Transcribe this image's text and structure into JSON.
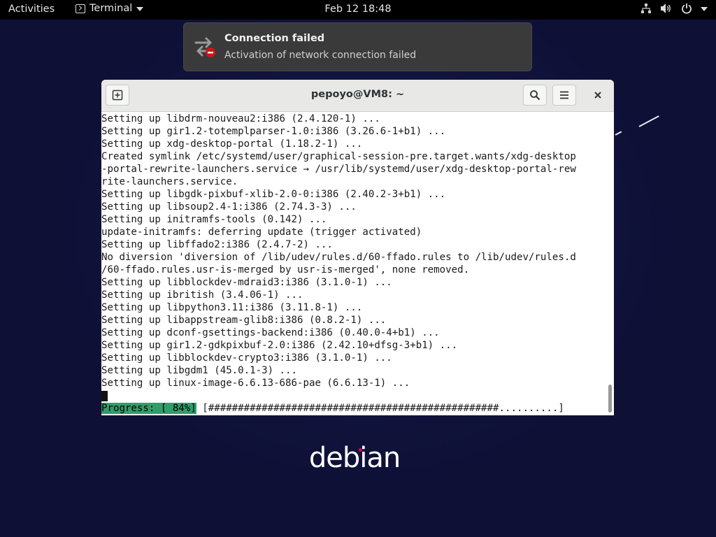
{
  "topbar": {
    "activities": "Activities",
    "app_name": "Terminal",
    "clock": "Feb 12  18:48"
  },
  "notification": {
    "title": "Connection failed",
    "body": "Activation of network connection failed",
    "icon": "network-error-icon"
  },
  "terminal": {
    "title": "pepoyo@VM8: ~",
    "lines": [
      "Setting up libdrm-nouveau2:i386 (2.4.120-1) ...",
      "Setting up gir1.2-totemplparser-1.0:i386 (3.26.6-1+b1) ...",
      "Setting up xdg-desktop-portal (1.18.2-1) ...",
      "Created symlink /etc/systemd/user/graphical-session-pre.target.wants/xdg-desktop",
      "-portal-rewrite-launchers.service → /usr/lib/systemd/user/xdg-desktop-portal-rew",
      "rite-launchers.service.",
      "Setting up libgdk-pixbuf-xlib-2.0-0:i386 (2.40.2-3+b1) ...",
      "Setting up libsoup2.4-1:i386 (2.74.3-3) ...",
      "Setting up initramfs-tools (0.142) ...",
      "update-initramfs: deferring update (trigger activated)",
      "Setting up libffado2:i386 (2.4.7-2) ...",
      "No diversion 'diversion of /lib/udev/rules.d/60-ffado.rules to /lib/udev/rules.d",
      "/60-ffado.rules.usr-is-merged by usr-is-merged', none removed.",
      "Setting up libblockdev-mdraid3:i386 (3.1.0-1) ...",
      "Setting up ibritish (3.4.06-1) ...",
      "Setting up libpython3.11:i386 (3.11.8-1) ...",
      "Setting up libappstream-glib8:i386 (0.8.2-1) ...",
      "Setting up dconf-gsettings-backend:i386 (0.40.0-4+b1) ...",
      "Setting up gir1.2-gdkpixbuf-2.0:i386 (2.42.10+dfsg-3+b1) ...",
      "Setting up libblockdev-crypto3:i386 (3.1.0-1) ...",
      "Setting up libgdm1 (45.0.1-3) ...",
      "Setting up linux-image-6.6.13-686-pae (6.6.13-1) ..."
    ],
    "progress_label": "Progress: [ 84%]",
    "progress_bar": " [#################################################..........]",
    "progress_percent": 84
  },
  "wallpaper": {
    "logo_text": "debian"
  },
  "colors": {
    "topbar_bg": "#000000",
    "desktop_bg": "#0e1036",
    "progress_label_bg": "#2e9f6b",
    "debian_accent": "#d70a53"
  }
}
